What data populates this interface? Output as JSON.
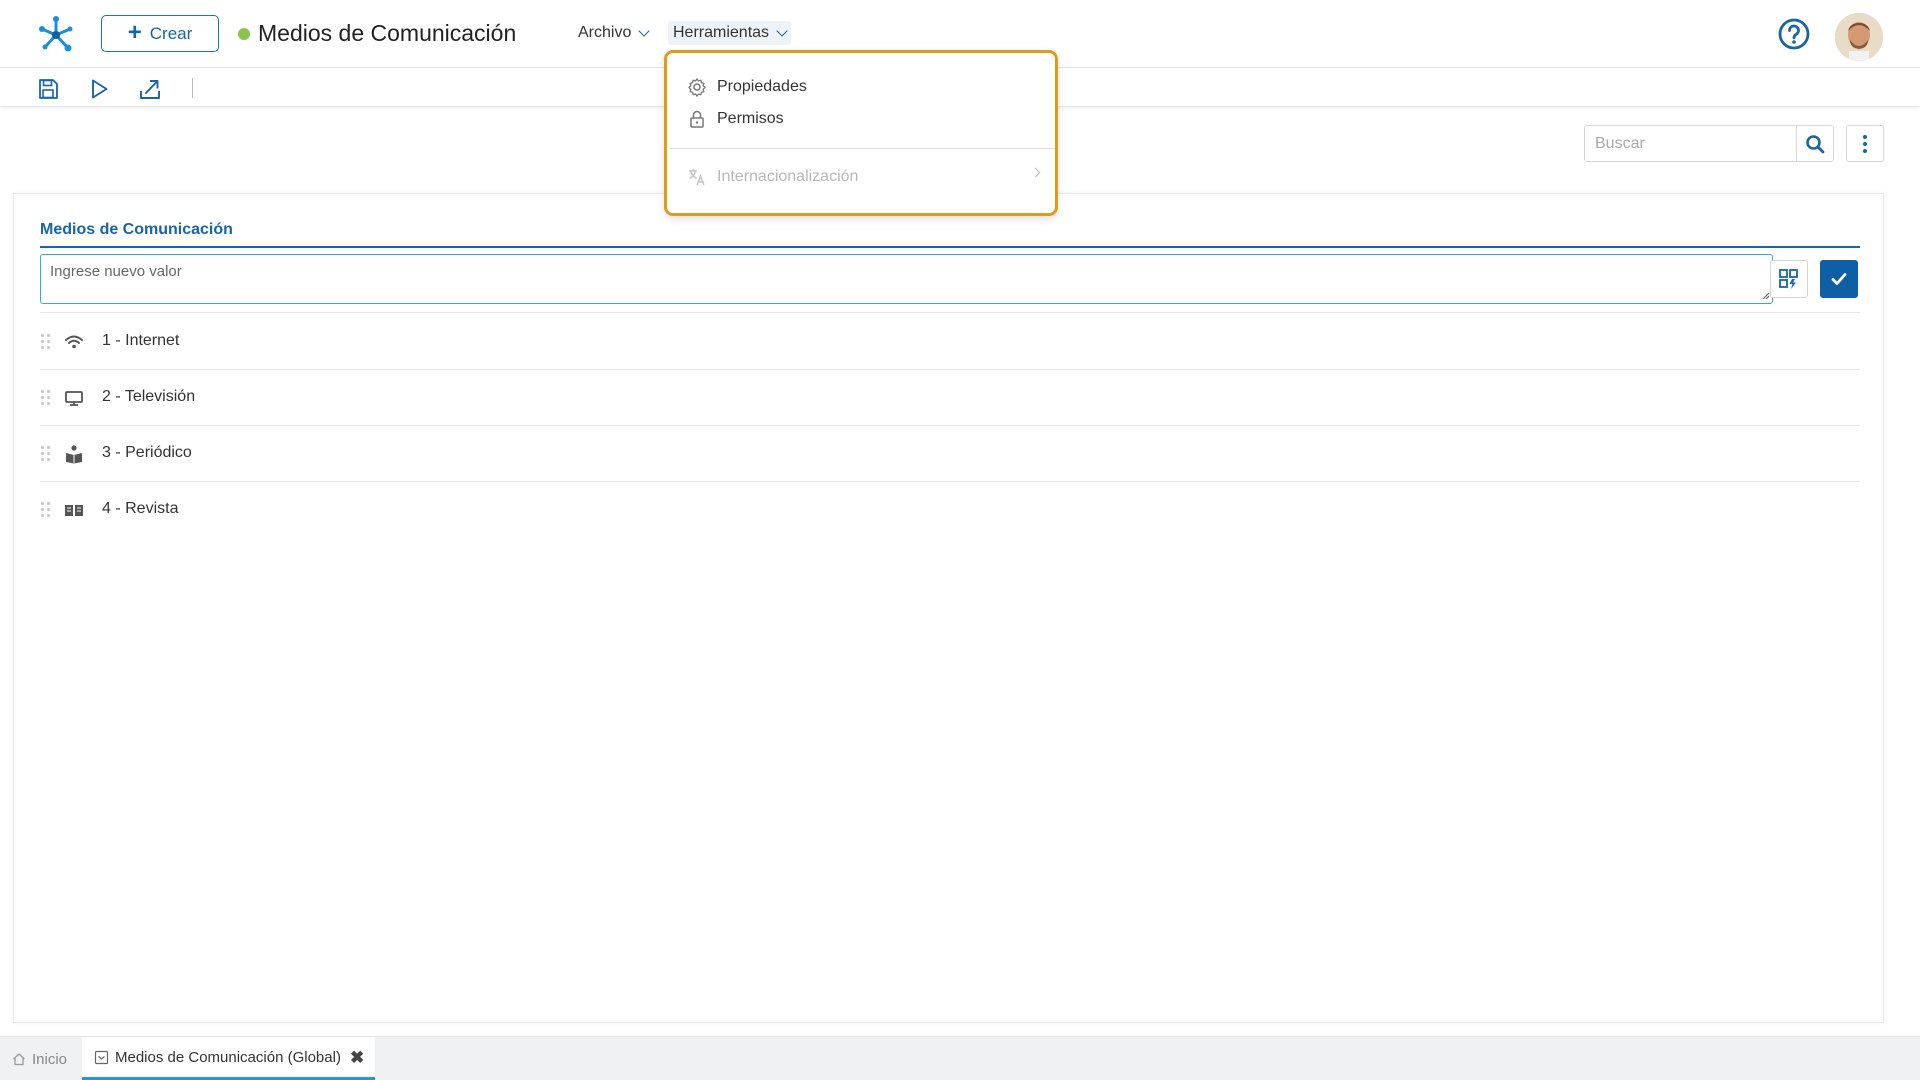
{
  "header": {
    "create_label": "Crear",
    "title": "Medios de Comunicación",
    "status_color": "#8bc34a",
    "menus": [
      {
        "label": "Archivo"
      },
      {
        "label": "Herramientas"
      }
    ]
  },
  "tools_menu": {
    "items": [
      {
        "label": "Propiedades",
        "icon": "gear-icon",
        "enabled": true
      },
      {
        "label": "Permisos",
        "icon": "lock-icon",
        "enabled": true
      },
      {
        "label": "Internacionalización",
        "icon": "translate-icon",
        "enabled": false
      }
    ]
  },
  "toolbar": {
    "icons": [
      "save-icon",
      "play-icon",
      "export-icon"
    ]
  },
  "search": {
    "placeholder": "Buscar"
  },
  "panel": {
    "title": "Medios de Comunicación",
    "input_placeholder": "Ingrese nuevo valor",
    "items": [
      {
        "label": "1 - Internet",
        "icon": "wifi-icon"
      },
      {
        "label": "2 - Televisión",
        "icon": "monitor-icon"
      },
      {
        "label": "3 - Periódico",
        "icon": "newspaper-reader-icon"
      },
      {
        "label": "4 - Revista",
        "icon": "open-book-icon"
      }
    ]
  },
  "bottom_tabs": [
    {
      "label": "Inicio",
      "active": false
    },
    {
      "label": "Medios de Comunicación (Global)",
      "active": true
    }
  ],
  "colors": {
    "primary": "#1565a8",
    "accent_border": "#e09a1e",
    "active_tab": "#1a9ae0"
  }
}
